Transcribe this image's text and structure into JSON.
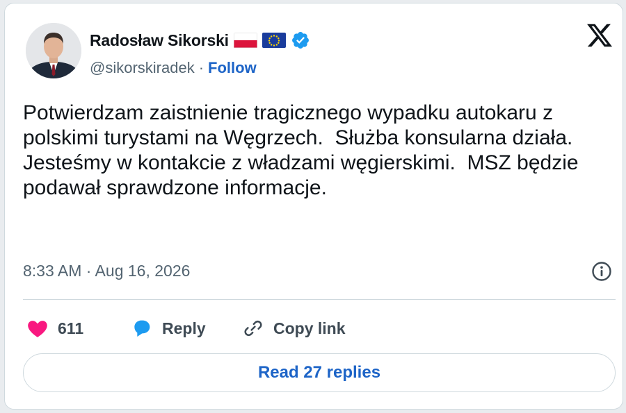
{
  "author": {
    "name": "Radosław Sikorski",
    "handle": "@sikorskiradek",
    "separator": "·",
    "follow_label": "Follow"
  },
  "badges": [
    "poland-flag-icon",
    "eu-flag-icon",
    "verified-badge-icon"
  ],
  "tweet": {
    "text": "Potwierdzam zaistnienie tragicznego wypadku autokaru z polskimi turystami na Węgrzech.  Służba konsularna działa. Jesteśmy w kontakcie z władzami węgierskimi.  MSZ będzie podawał sprawdzone informacje.",
    "timestamp": "8:33 AM · Aug 16, 2026"
  },
  "actions": {
    "like_count": "611",
    "reply_label": "Reply",
    "copy_label": "Copy link"
  },
  "replies_button_label": "Read 27 replies",
  "colors": {
    "link_blue": "#1d64c7",
    "like_pink": "#f91880",
    "reply_blue": "#1d9bf0",
    "verified_blue": "#1d9bf0",
    "muted_text": "#536471",
    "border": "#cfd9de"
  }
}
